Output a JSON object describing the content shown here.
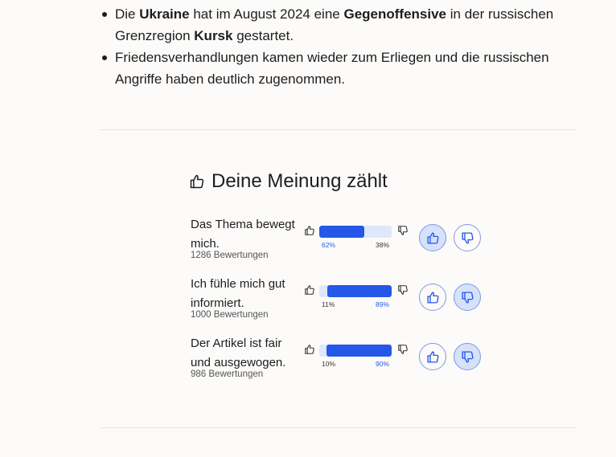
{
  "article": {
    "bullets": [
      {
        "parts": [
          {
            "text": "Die ",
            "bold": false
          },
          {
            "text": "Ukraine",
            "bold": true
          },
          {
            "text": " hat im August 2024 eine ",
            "bold": false
          },
          {
            "text": "Gegenoffensive",
            "bold": true
          },
          {
            "text": " in der russischen Grenzregion ",
            "bold": false
          },
          {
            "text": "Kursk",
            "bold": true
          },
          {
            "text": " gestartet.",
            "bold": false
          }
        ]
      },
      {
        "parts": [
          {
            "text": "Friedensverhandlungen kamen wieder zum Erliegen und die russischen Angriffe haben deutlich zugenommen.",
            "bold": false
          }
        ]
      }
    ]
  },
  "poll": {
    "title": "Deine Meinung zählt",
    "title_icon": "thumbs-up-outline-icon",
    "accent_color": "#2557e8",
    "questions": [
      {
        "text": "Das Thema bewegt mich.",
        "count": "1286 Bewertungen",
        "up": 62,
        "down": 38,
        "up_label": "62%",
        "down_label": "38%",
        "up_active": true,
        "down_active": false
      },
      {
        "text": "Ich fühle mich gut informiert.",
        "count": "1000 Bewertungen",
        "up": 11,
        "down": 89,
        "up_label": "11%",
        "down_label": "89%",
        "up_active": false,
        "down_active": true
      },
      {
        "text": "Der Artikel ist fair und ausgewogen.",
        "count": "986 Bewertungen",
        "up": 10,
        "down": 90,
        "up_label": "10%",
        "down_label": "90%",
        "up_active": false,
        "down_active": true
      }
    ]
  }
}
